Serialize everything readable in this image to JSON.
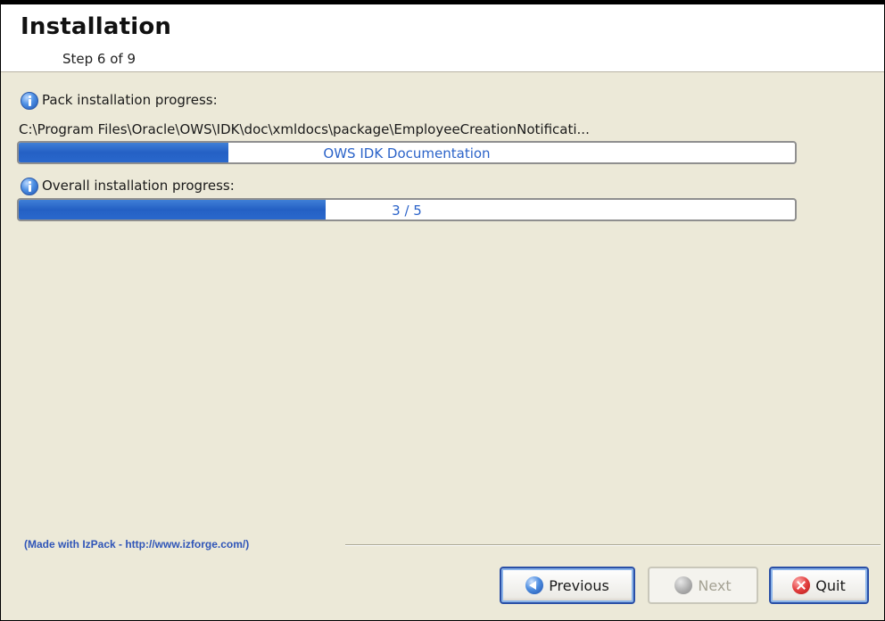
{
  "header": {
    "title": "Installation",
    "step": "Step 6 of 9"
  },
  "pack_progress": {
    "label": "Pack installation progress:",
    "current_file": "C:\\Program Files\\Oracle\\OWS\\IDK\\doc\\xmldocs\\package\\EmployeeCreationNotificati...",
    "bar_text": "OWS IDK Documentation",
    "fraction": 0.27
  },
  "overall_progress": {
    "label": "Overall installation progress:",
    "bar_text": "3 / 5",
    "fraction": 0.395
  },
  "footer": {
    "made_with": "(Made with IzPack - http://www.izforge.com/)"
  },
  "buttons": {
    "previous": "Previous",
    "next": "Next",
    "quit": "Quit"
  },
  "icons": {
    "info": "info-icon",
    "previous": "arrow-left-icon",
    "next": "arrow-right-icon",
    "quit": "close-icon"
  },
  "colors": {
    "progress_fill": "#2a68cc",
    "progress_text": "#2b63c9",
    "background": "#ece9d8",
    "footer_link": "#2f55b8"
  }
}
